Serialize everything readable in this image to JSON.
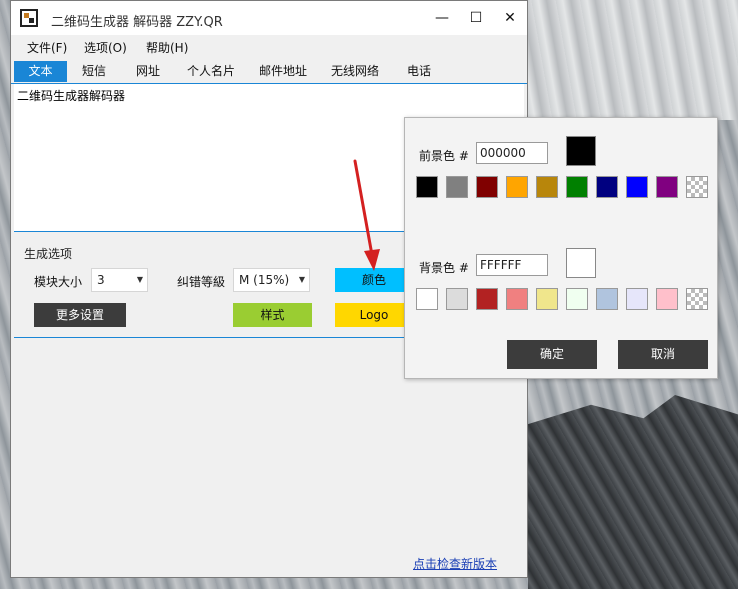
{
  "window": {
    "title": "二维码生成器 解码器 ZZY.QR",
    "controls": {
      "minimize": "—",
      "maximize": "☐",
      "close": "✕"
    }
  },
  "menu": [
    "文件(F)",
    "选项(O)",
    "帮助(H)"
  ],
  "tabs": [
    "文本",
    "短信",
    "网址",
    "个人名片",
    "邮件地址",
    "无线网络",
    "电话"
  ],
  "active_tab": "文本",
  "text_content": "二维码生成器解码器",
  "options": {
    "title": "生成选项",
    "module_size_label": "模块大小",
    "module_size_value": "3",
    "error_level_label": "纠错等級",
    "error_level_value": "M (15%)",
    "color_button": "颜色",
    "more_settings_button": "更多设置",
    "style_button": "样式",
    "logo_button": "Logo"
  },
  "update_link": "点击检查新版本",
  "color_dialog": {
    "foreground_label": "前景色 #",
    "foreground_value": "000000",
    "foreground_swatches": [
      "#000000",
      "#808080",
      "#800000",
      "#ffa500",
      "#b8860b",
      "#008000",
      "#000080",
      "#0000ff",
      "#800080",
      "checker"
    ],
    "background_label": "背景色 #",
    "background_value": "FFFFFF",
    "background_swatches": [
      "#ffffff",
      "#dcdcdc",
      "#b22222",
      "#f08080",
      "#f0e68c",
      "#f0fff0",
      "#b0c4de",
      "#e6e6fa",
      "#ffc0cb",
      "checker"
    ],
    "ok_button": "确定",
    "cancel_button": "取消"
  },
  "colors": {
    "accent": "#1a86d6",
    "color_button_bg": "#00bfff",
    "style_button_bg": "#9acd32",
    "logo_button_bg": "#ffd700",
    "dark_button_bg": "#3c3c3c",
    "annotation_arrow": "#d42020"
  }
}
